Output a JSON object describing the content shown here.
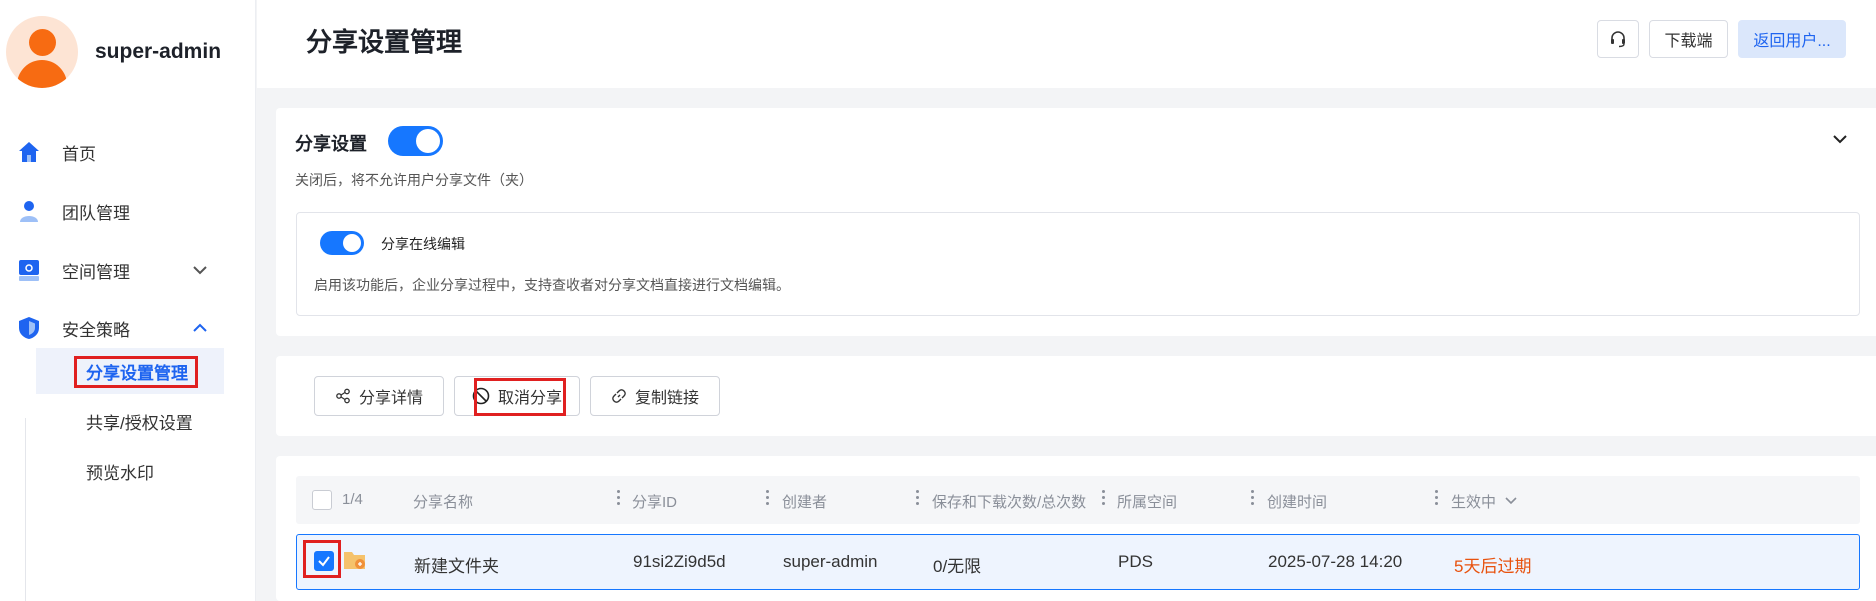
{
  "sidebar": {
    "username": "super-admin",
    "nav": [
      {
        "label": "首页",
        "icon": "home-icon"
      },
      {
        "label": "团队管理",
        "icon": "team-icon"
      },
      {
        "label": "空间管理",
        "icon": "storage-icon",
        "expanded": false
      },
      {
        "label": "安全策略",
        "icon": "shield-icon",
        "expanded": true
      }
    ],
    "sub_items": [
      {
        "label": "分享设置管理",
        "active": true
      },
      {
        "label": "共享/授权设置",
        "active": false
      },
      {
        "label": "预览水印",
        "active": false
      }
    ]
  },
  "header": {
    "title": "分享设置管理",
    "support_icon": "headset-icon",
    "download_label": "下载端",
    "return_label": "返回用户..."
  },
  "share_settings": {
    "title": "分享设置",
    "enabled": true,
    "description": "关闭后，将不允许用户分享文件（夹）",
    "online_edit": {
      "label": "分享在线编辑",
      "enabled": true,
      "description": "启用该功能后，企业分享过程中，支持查收者对分享文档直接进行文档编辑。"
    }
  },
  "toolbar": {
    "details_label": "分享详情",
    "cancel_label": "取消分享",
    "copy_label": "复制链接"
  },
  "table": {
    "selection": "1/4",
    "columns": [
      "分享名称",
      "分享ID",
      "创建者",
      "保存和下载次数/总次数",
      "所属空间",
      "创建时间",
      "生效中"
    ],
    "rows": [
      {
        "selected": true,
        "name": "新建文件夹",
        "share_id": "91si2Zi9d5d",
        "creator": "super-admin",
        "counts": "0/无限",
        "space": "PDS",
        "created": "2025-07-28 14:20",
        "status": "5天后过期"
      }
    ]
  },
  "colors": {
    "accent": "#1677ff",
    "expire": "#e8520e",
    "highlight": "#e02020"
  }
}
